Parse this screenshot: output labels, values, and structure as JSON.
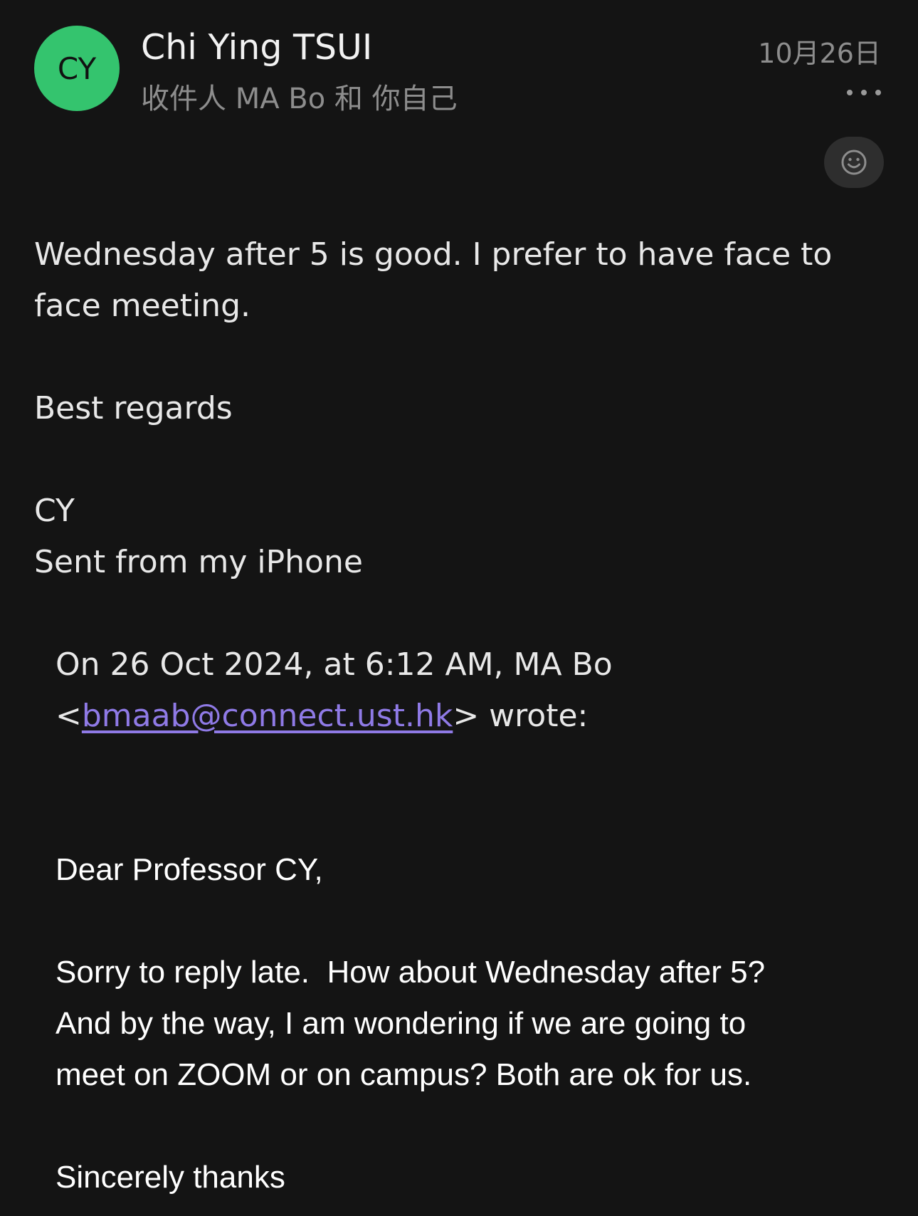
{
  "header": {
    "avatar_initials": "CY",
    "avatar_color": "#34c46e",
    "sender_name": "Chi Ying TSUI",
    "recipients": "收件人 MA Bo 和 你自己",
    "date": "10月26日",
    "more_icon": "ellipsis-icon",
    "reaction_icon": "smiley-icon"
  },
  "message": {
    "line1": "Wednesday after 5 is good. I prefer to have face to",
    "line2": "face meeting.",
    "closing": "Best regards",
    "signature": "CY",
    "device_note": "Sent from my iPhone"
  },
  "quote": {
    "attribution_prefix": "On 26 Oct 2024, at 6:12 AM, MA Bo",
    "open_bracket": "<",
    "email": "bmaab@connect.ust.hk",
    "close_suffix": "> wrote:",
    "greeting": "Dear Professor CY,",
    "para_line1": "Sorry to reply late.  How about Wednesday after 5?",
    "para_line2": "And by the way, I am wondering if we are going to",
    "para_line3": "meet on ZOOM or on campus? Both are ok for us.",
    "closing": "Sincerely thanks"
  },
  "colors": {
    "background": "#141414",
    "link": "#8f7ae6",
    "muted_text": "#8d8d8d"
  }
}
